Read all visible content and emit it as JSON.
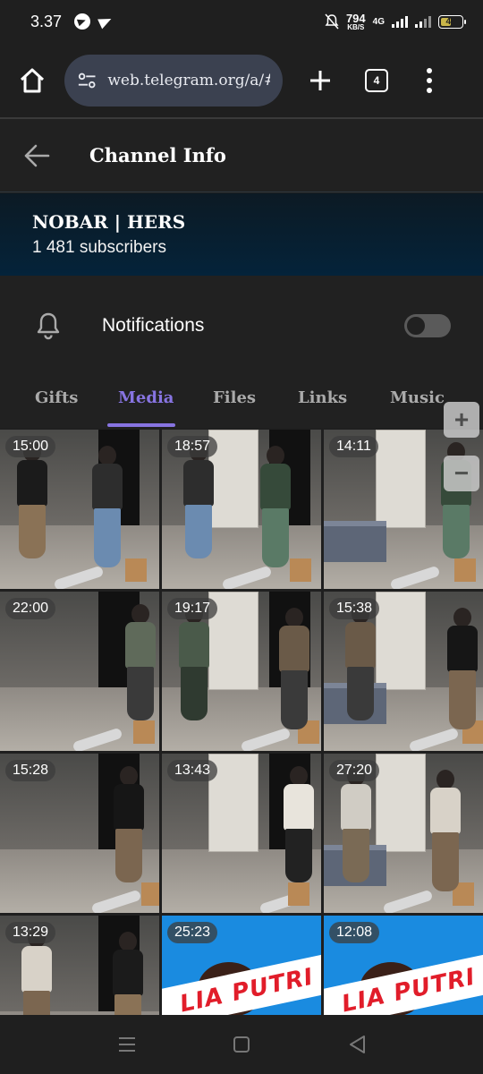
{
  "status_bar": {
    "time": "3.37",
    "net_speed": "794",
    "net_speed_unit": "KB/S",
    "network_type": "4G",
    "battery": "44"
  },
  "browser": {
    "url": "web.telegram.org/a/#-",
    "tab_count": "4"
  },
  "header": {
    "title": "Channel Info"
  },
  "channel": {
    "name": "NOBAR | HERS",
    "subscribers": "1 481 subscribers"
  },
  "notifications": {
    "label": "Notifications",
    "enabled": false
  },
  "tabs": [
    {
      "label": "Gifts",
      "active": false
    },
    {
      "label": "Media",
      "active": true
    },
    {
      "label": "Files",
      "active": false
    },
    {
      "label": "Links",
      "active": false
    },
    {
      "label": "Music",
      "active": false
    }
  ],
  "zoom": {
    "in": "+",
    "out": "−"
  },
  "media": [
    {
      "duration": "15:00",
      "kind": "room"
    },
    {
      "duration": "18:57",
      "kind": "room"
    },
    {
      "duration": "14:11",
      "kind": "room"
    },
    {
      "duration": "22:00",
      "kind": "room"
    },
    {
      "duration": "19:17",
      "kind": "room"
    },
    {
      "duration": "15:38",
      "kind": "room"
    },
    {
      "duration": "15:28",
      "kind": "room"
    },
    {
      "duration": "13:43",
      "kind": "room"
    },
    {
      "duration": "27:20",
      "kind": "room"
    },
    {
      "duration": "13:29",
      "kind": "room"
    },
    {
      "duration": "25:23",
      "kind": "promo",
      "overlay_text": "LIA PUTRI"
    },
    {
      "duration": "12:08",
      "kind": "promo",
      "overlay_text": "LIA PUTRI"
    }
  ]
}
